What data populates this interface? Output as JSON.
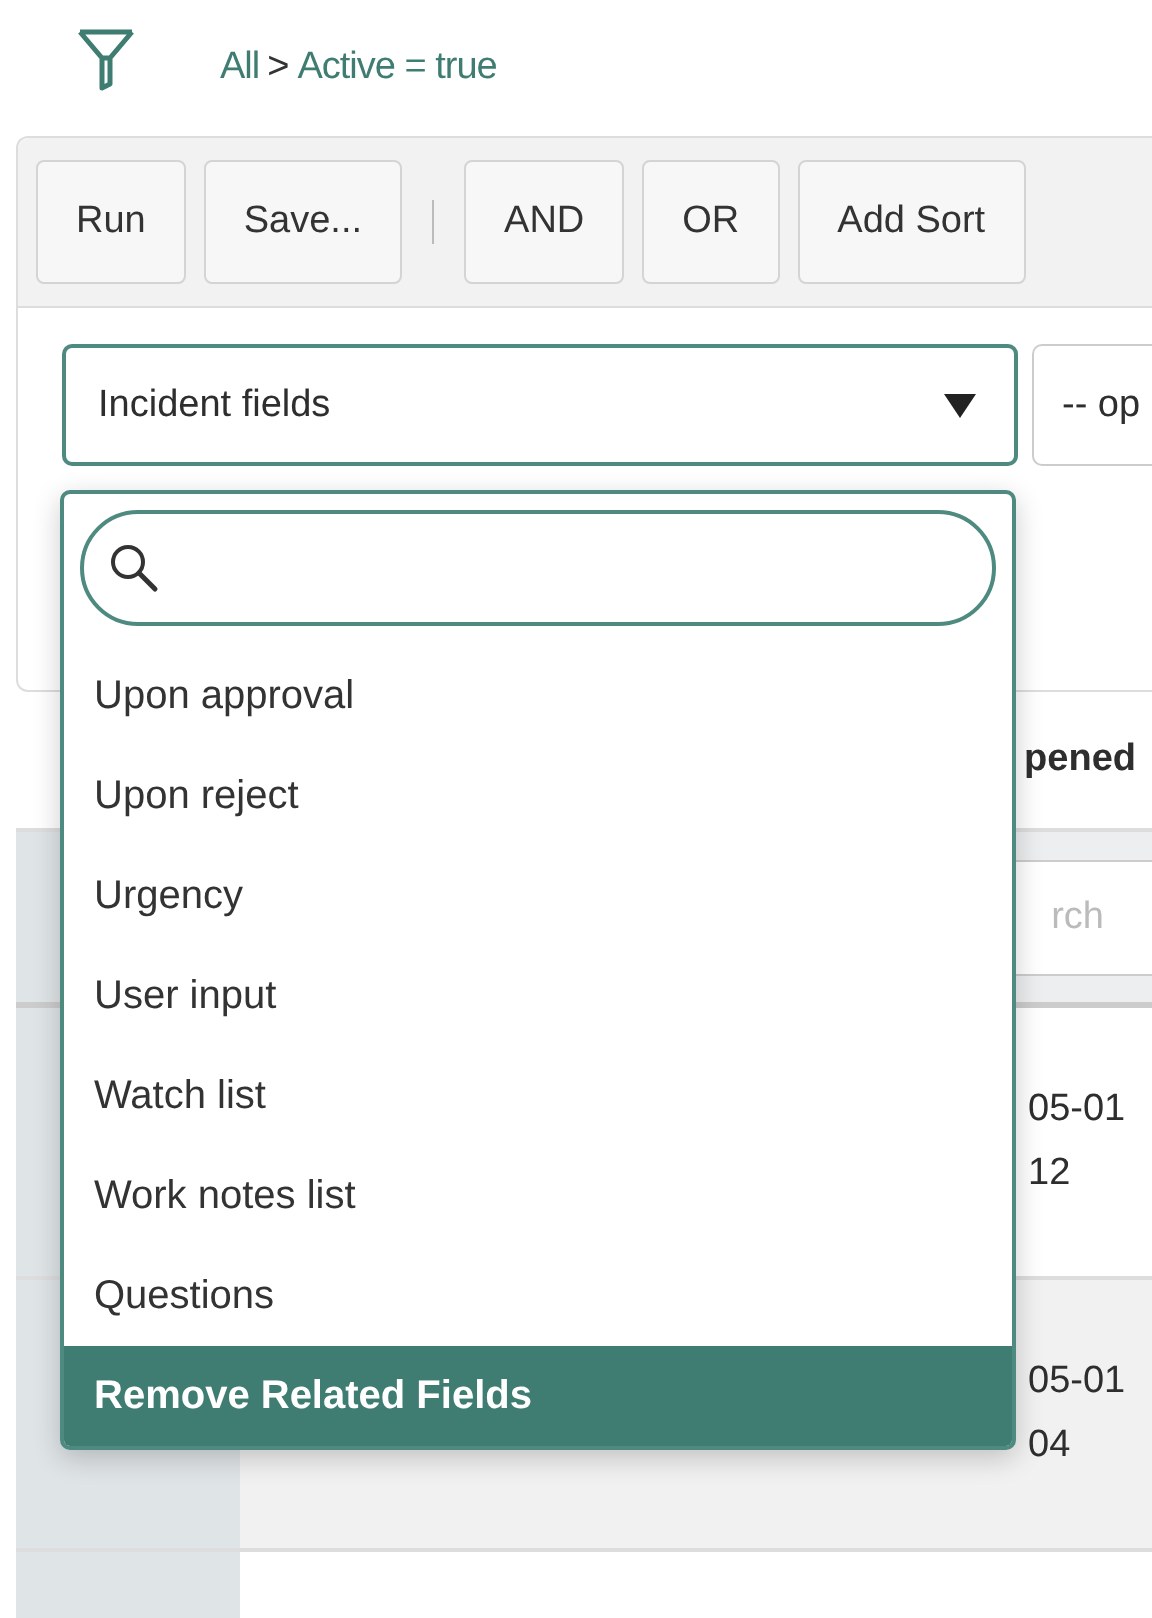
{
  "breadcrumb": {
    "items": [
      {
        "label": "All"
      },
      {
        "label": "Active = true"
      }
    ],
    "separator": ">"
  },
  "toolbar": {
    "buttons": [
      "Run",
      "Save...",
      "AND",
      "OR",
      "Add Sort"
    ]
  },
  "condition": {
    "field": "Incident fields",
    "operator": "-- op"
  },
  "dropdown": {
    "search": {
      "focused": true
    },
    "items": [
      {
        "label": "Upon approval",
        "selected": false
      },
      {
        "label": "Upon reject",
        "selected": false
      },
      {
        "label": "Urgency",
        "selected": false
      },
      {
        "label": "User input",
        "selected": false
      },
      {
        "label": "Watch list",
        "selected": false
      },
      {
        "label": "Work notes list",
        "selected": false
      },
      {
        "label": "Questions",
        "selected": false
      },
      {
        "label": "Remove Related Fields",
        "selected": true
      }
    ]
  },
  "table": {
    "column_header": "pened",
    "search_placeholder": "rch",
    "rows": [
      {
        "lines": [
          "05-01",
          "12"
        ]
      },
      {
        "lines": [
          "05-01",
          "04"
        ]
      }
    ]
  }
}
